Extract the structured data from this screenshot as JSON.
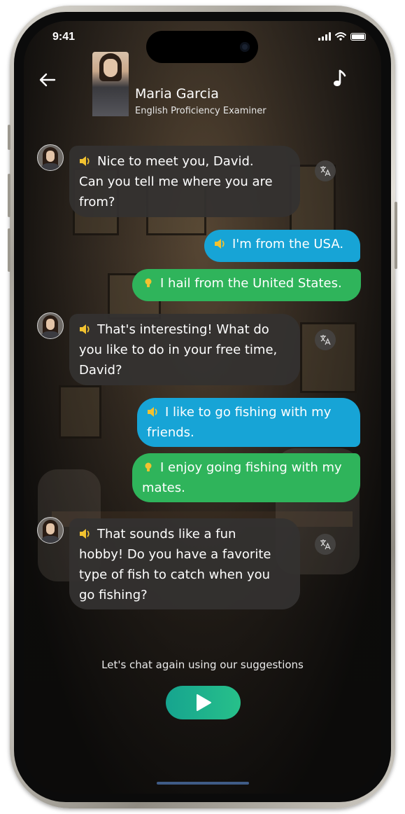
{
  "status": {
    "time": "9:41"
  },
  "header": {
    "name": "Maria Garcia",
    "role": "English Proficiency Examiner"
  },
  "messages": [
    {
      "from": "ai",
      "text_lines": [
        "Nice to meet you, David.",
        "Can you tell me  where you are",
        "from?"
      ]
    },
    {
      "from": "me",
      "text_lines": [
        "I'm from the USA."
      ]
    },
    {
      "from": "suggestion",
      "text_lines": [
        "I hail from the United States."
      ]
    },
    {
      "from": "ai",
      "text_lines": [
        "That's interesting! What do",
        "you like to do in your free time,",
        "David?"
      ]
    },
    {
      "from": "me",
      "text_lines": [
        "I like to go fishing with my",
        "friends."
      ]
    },
    {
      "from": "suggestion",
      "text_lines": [
        "I enjoy going fishing with my",
        "mates."
      ]
    },
    {
      "from": "ai",
      "text_lines": [
        "That sounds like a fun",
        "hobby! Do you have a favorite",
        "type of fish to catch when you",
        "go fishing?"
      ]
    }
  ],
  "footer": {
    "suggest_text": "Let's chat again using our suggestions"
  },
  "icons": {
    "back": "arrow-left-icon",
    "music": "music-note-icon",
    "speaker": "speaker-icon",
    "bulb": "lightbulb-icon",
    "translate": "translate-icon",
    "play": "play-icon"
  },
  "colors": {
    "user_bubble": "#17a4d6",
    "suggestion_bubble": "#2fb45b",
    "ai_bubble": "#343230",
    "speaker_icon": "#f2c230",
    "play_button": "#1fb38d"
  }
}
